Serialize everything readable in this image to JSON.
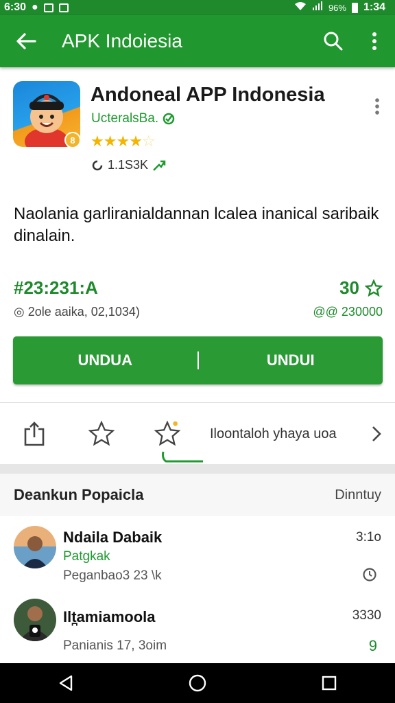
{
  "status_bar": {
    "time_left": "6:30",
    "battery": "96%",
    "time_right": "1:34"
  },
  "app_bar": {
    "title": "APK Indoiesia",
    "icons": [
      "back-arrow-icon",
      "search-icon",
      "more-vert-icon"
    ]
  },
  "app": {
    "title": "Andoneal APP Indonesia",
    "developer": "UcteralsBa.",
    "rating_stars": 4,
    "meta": "1.1S3K",
    "badge": "8"
  },
  "description": "Naolania garliranialdannan lcalea inanical saribaik dinalain.",
  "stats": {
    "left_main": "#23:231:A",
    "left_sub": "2ole aaika, 02,1034)",
    "right_main": "30",
    "right_sub": "@@ 230000"
  },
  "install": {
    "left_label": "UNDUA",
    "right_label": "UNDUI"
  },
  "actions": {
    "more_label": "Iloontaloh yhaya uoa",
    "icons": [
      "share-icon",
      "star-outline-icon",
      "star-badge-icon",
      "chevron-right-icon"
    ]
  },
  "section": {
    "title": "Deankun Popaicla",
    "link": "Dinntuy"
  },
  "list": [
    {
      "name": "Ndaila Dabaik",
      "sub": "Patgkak",
      "meta": "Peganbao3 23 \\k",
      "right_top": "3:1o",
      "right_bot_icon": "clock-icon"
    },
    {
      "name": "Ilt̪amiamoola",
      "sub": "",
      "meta": "Panianis 17, 3oim",
      "right_top": "3330",
      "right_bot": "9"
    }
  ],
  "colors": {
    "primary": "#21972f",
    "status": "#1e8a2c",
    "accent_star": "#f4b400"
  }
}
